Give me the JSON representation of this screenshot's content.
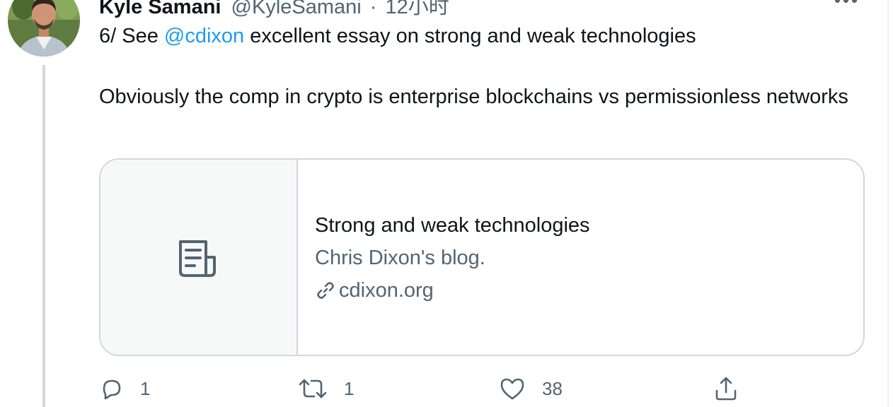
{
  "tweet": {
    "author_name": "Kyle Samani",
    "author_handle": "@KyleSamani",
    "separator": "·",
    "time": "12小时",
    "text_part1": "6/ See ",
    "mention": "@cdixon",
    "text_part2": " excellent essay on strong and weak technologies",
    "text_paragraph2": "Obviously the comp in crypto is enterprise blockchains vs permissionless networks"
  },
  "card": {
    "title": "Strong and weak technologies",
    "description": "Chris Dixon's blog.",
    "domain": "cdixon.org"
  },
  "actions": {
    "reply_count": "1",
    "retweet_count": "1",
    "like_count": "38"
  },
  "colors": {
    "link": "#1d9bf0",
    "secondary_text": "#536471",
    "border": "#cfd9de"
  },
  "icons": [
    "avatar-photo",
    "more-icon",
    "document-icon",
    "link-icon",
    "reply-icon",
    "retweet-icon",
    "like-icon",
    "share-icon"
  ]
}
